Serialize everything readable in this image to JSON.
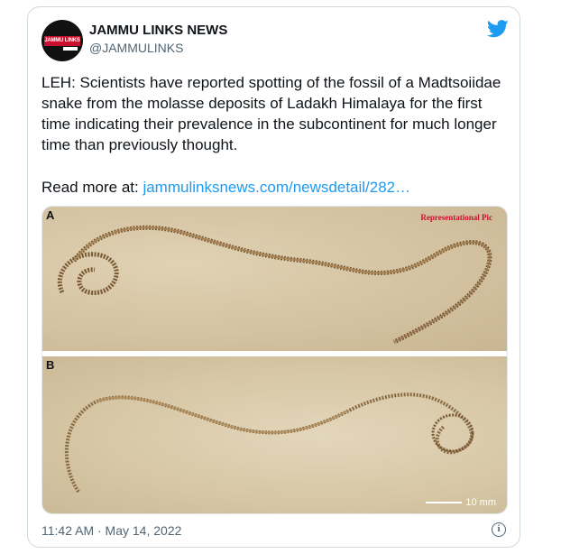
{
  "tweet": {
    "account_name": "JAMMU LINKS NEWS",
    "handle": "@JAMMULINKS",
    "avatar_logo_text": "JAMMU LINKS",
    "body": "LEH: Scientists have reported spotting of the fossil of a Madtsoiidae snake from the molasse deposits of Ladakh Himalaya for the first time indicating their prevalence in the subcontinent for much longer time than previously thought.",
    "read_more_prefix": "Read more at: ",
    "read_more_link": "jammulinksnews.com/newsdetail/282…",
    "timestamp": "11:42 AM · May 14, 2022",
    "info_glyph": "i"
  },
  "media": {
    "panel_a_label": "A",
    "panel_b_label": "B",
    "watermark": "Representational Pic",
    "scale_label": "10 mm"
  },
  "colors": {
    "link": "#1d9bf0",
    "twitter_blue": "#1d9bf0",
    "text": "#0f1419",
    "muted": "#536471",
    "watermark_red": "#c8102e"
  },
  "icons": {
    "brand": "twitter-bird-icon",
    "info": "info-icon"
  }
}
